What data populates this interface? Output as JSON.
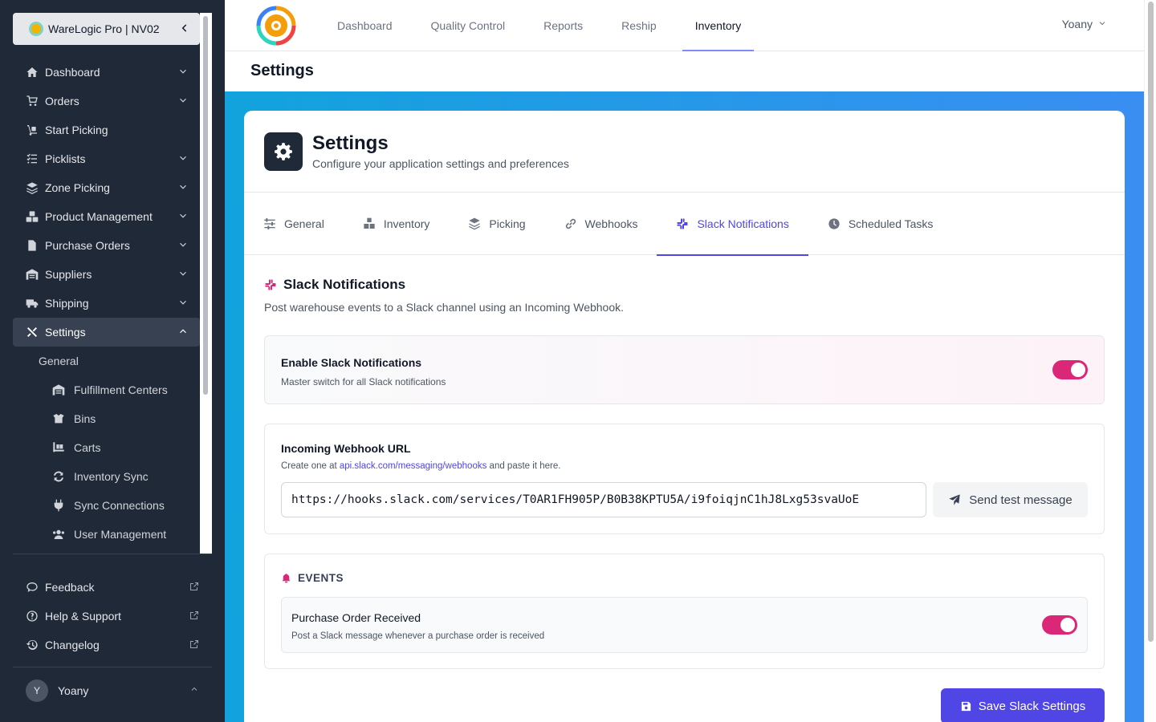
{
  "org": {
    "name": "WareLogic Pro | NV02"
  },
  "sidebar": {
    "items": [
      {
        "label": "Dashboard",
        "icon": "home-icon"
      },
      {
        "label": "Orders",
        "icon": "cart-icon"
      },
      {
        "label": "Start Picking",
        "icon": "dolly-icon"
      },
      {
        "label": "Picklists",
        "icon": "list-check-icon"
      },
      {
        "label": "Zone Picking",
        "icon": "layers-icon"
      },
      {
        "label": "Product Management",
        "icon": "cubes-icon"
      },
      {
        "label": "Purchase Orders",
        "icon": "file-invoice-icon"
      },
      {
        "label": "Suppliers",
        "icon": "warehouse-icon"
      },
      {
        "label": "Shipping",
        "icon": "truck-icon"
      },
      {
        "label": "Settings",
        "icon": "tools-icon"
      }
    ],
    "settings_sub": {
      "heading": "General",
      "items": [
        {
          "label": "Fulfillment Centers",
          "icon": "warehouse-icon"
        },
        {
          "label": "Bins",
          "icon": "box-open-icon"
        },
        {
          "label": "Carts",
          "icon": "pallet-icon"
        },
        {
          "label": "Inventory Sync",
          "icon": "sync-icon"
        },
        {
          "label": "Sync Connections",
          "icon": "plug-icon"
        },
        {
          "label": "User Management",
          "icon": "users-icon"
        }
      ]
    },
    "bottom": [
      {
        "label": "Feedback",
        "icon": "comment-icon"
      },
      {
        "label": "Help & Support",
        "icon": "help-icon"
      },
      {
        "label": "Changelog",
        "icon": "history-icon"
      }
    ],
    "user": {
      "initial": "Y",
      "name": "Yoany"
    }
  },
  "topnav": {
    "items": [
      "Dashboard",
      "Quality Control",
      "Reports",
      "Reship",
      "Inventory"
    ],
    "active": "Inventory",
    "user": "Yoany"
  },
  "page": {
    "title": "Settings"
  },
  "card": {
    "title": "Settings",
    "subtitle": "Configure your application settings and preferences"
  },
  "tabs": [
    {
      "label": "General",
      "icon": "sliders-icon"
    },
    {
      "label": "Inventory",
      "icon": "boxes-icon"
    },
    {
      "label": "Picking",
      "icon": "layers-icon"
    },
    {
      "label": "Webhooks",
      "icon": "link-icon"
    },
    {
      "label": "Slack Notifications",
      "icon": "slack-icon"
    },
    {
      "label": "Scheduled Tasks",
      "icon": "clock-icon"
    }
  ],
  "slack": {
    "title": "Slack Notifications",
    "description": "Post warehouse events to a Slack channel using an Incoming Webhook.",
    "enable": {
      "title": "Enable Slack Notifications",
      "description": "Master switch for all Slack notifications",
      "on": true
    },
    "webhook": {
      "title": "Incoming Webhook URL",
      "desc_prefix": "Create one at",
      "link": "api.slack.com/messaging/webhooks",
      "desc_suffix": "and paste it here.",
      "value": "https://hooks.slack.com/services/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",
      "test_label": "Send test message"
    },
    "events": {
      "heading": "EVENTS",
      "items": [
        {
          "title": "Purchase Order Received",
          "description": "Post a Slack message whenever a purchase order is received",
          "on": true
        }
      ]
    },
    "save_label": "Save Slack Settings"
  },
  "colors": {
    "accent": "#4f46e5",
    "toggle": "#db2777",
    "sidebar": "#1f2937"
  }
}
